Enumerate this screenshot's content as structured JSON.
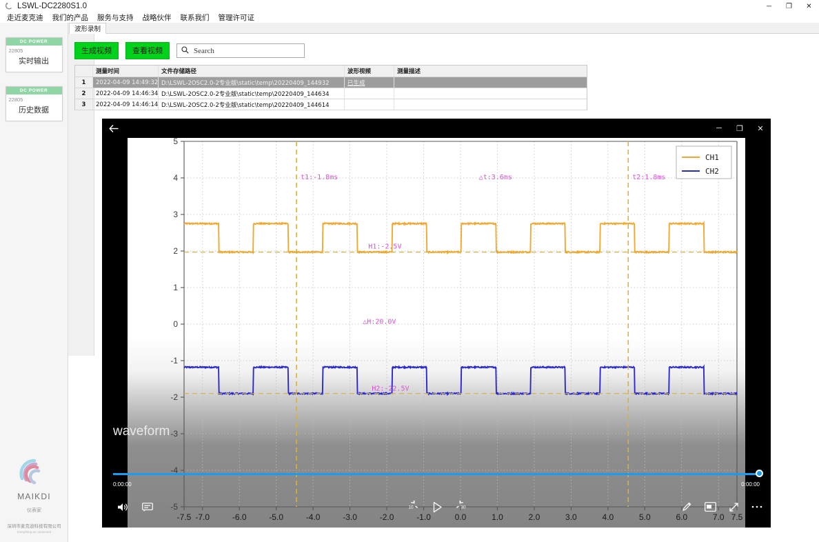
{
  "window": {
    "title": "LSWL-DC2280S1.0",
    "app_icon": "app-icon",
    "minimize": "─",
    "maximize": "❐",
    "close": "✕"
  },
  "menu": {
    "items": [
      {
        "label": "走近麦克迪"
      },
      {
        "label": "我们的产品"
      },
      {
        "label": "服务与支持"
      },
      {
        "label": "战略伙伴"
      },
      {
        "label": "联系我们"
      },
      {
        "label": "管理许可证"
      }
    ]
  },
  "sidebar": {
    "cards": [
      {
        "header": "DC POWER",
        "model": "22805",
        "label": "实时输出"
      },
      {
        "header": "DC POWER",
        "model": "22805",
        "label": "历史数据"
      }
    ],
    "brand": {
      "name": "MAIKDI",
      "sub": "仪表家",
      "company": "深圳市麦克迪科技有限公司",
      "slogan": "Everything as connected"
    }
  },
  "tabs": [
    {
      "label": "波形录制",
      "active": true
    }
  ],
  "toolbar": {
    "generate_video_label": "生成视频",
    "view_video_label": "查看视频",
    "search_placeholder": "Search",
    "search_value": "",
    "search_icon": "search-icon",
    "button_color": "#00d21b"
  },
  "table": {
    "columns": [
      "",
      "测量时间",
      "文件存储路径",
      "波形视频",
      "测量描述"
    ],
    "rows": [
      {
        "index": "1",
        "time": "2022-04-09 14:49:32",
        "path": "D:\\LSWL-2OSC2.0-2专业版\\static\\temp\\20220409_144932",
        "video": "已生成",
        "desc": "",
        "selected": true
      },
      {
        "index": "2",
        "time": "2022-04-09 14:46:34",
        "path": "D:\\LSWL-2OSC2.0-2专业版\\static\\temp\\20220409_144634",
        "video": "",
        "desc": "",
        "selected": false
      },
      {
        "index": "3",
        "time": "2022-04-09 14:46:14",
        "path": "D:\\LSWL-2OSC2.0-2专业版\\static\\temp\\20220409_144614",
        "video": "",
        "desc": "",
        "selected": false
      }
    ]
  },
  "player": {
    "back_icon": "back-arrow-icon",
    "minimize": "─",
    "maximize": "❐",
    "close": "✕",
    "watermark": "waveform",
    "time_current": "0:00:00",
    "time_total": "0:00:00",
    "seek_percent": 100,
    "controls": {
      "volume_icon": "volume-icon",
      "subtitles_icon": "subtitles-icon",
      "rewind_icon": "rewind-10-icon",
      "rewind_label": "10",
      "play_icon": "play-icon",
      "forward_icon": "forward-30-icon",
      "forward_label": "30",
      "draw_icon": "pen-icon",
      "pip_icon": "picture-in-picture-icon",
      "fullscreen_icon": "fullscreen-icon",
      "more_icon": "more-options-icon"
    }
  },
  "chart_data": {
    "type": "line",
    "title": "",
    "xlabel": "",
    "ylabel": "",
    "xlim": [
      -7.5,
      7.5
    ],
    "ylim": [
      -5,
      5
    ],
    "xticks": [
      "-7.5",
      "-7.0",
      "-6.0",
      "-5.0",
      "-4.0",
      "-3.0",
      "-2.0",
      "-1.0",
      "0.0",
      "1.0",
      "2.0",
      "3.0",
      "4.0",
      "5.0",
      "6.0",
      "7.0",
      "7.5"
    ],
    "yticks": [
      "5",
      "4",
      "3",
      "2",
      "1",
      "0",
      "-1",
      "-2",
      "-3",
      "-4",
      "-5"
    ],
    "grid": true,
    "legend_position": "top-right",
    "legend": [
      {
        "name": "CH1",
        "color": "#f0a830"
      },
      {
        "name": "CH2",
        "color": "#2a2acc"
      }
    ],
    "series": [
      {
        "name": "CH1",
        "color": "#f0a830",
        "type": "square-wave",
        "high": 2.75,
        "low": 1.97,
        "period": 1.88,
        "duty": 0.5,
        "phase": -7.5
      },
      {
        "name": "CH2",
        "color": "#2a2acc",
        "type": "square-wave",
        "high": -1.18,
        "low": -1.9,
        "period": 1.88,
        "duty": 0.5,
        "phase": -7.5
      }
    ],
    "cursors": {
      "vertical": [
        {
          "label": "t1:-1.8ms",
          "x": -4.45,
          "color": "#d8b23a"
        },
        {
          "label": "t2:1.8ms",
          "x": 4.55,
          "color": "#d8b23a"
        }
      ],
      "horizontal": [
        {
          "label": "H1:-2.5V",
          "y": 1.97,
          "color": "#d8b23a"
        },
        {
          "label": "H2:-22.5V",
          "y": -1.9,
          "color": "#d8b23a"
        }
      ],
      "deltas": [
        {
          "label": "△t:3.6ms"
        },
        {
          "label": "△H:20.0V"
        }
      ],
      "annotation_color": "#d94fd9"
    }
  }
}
